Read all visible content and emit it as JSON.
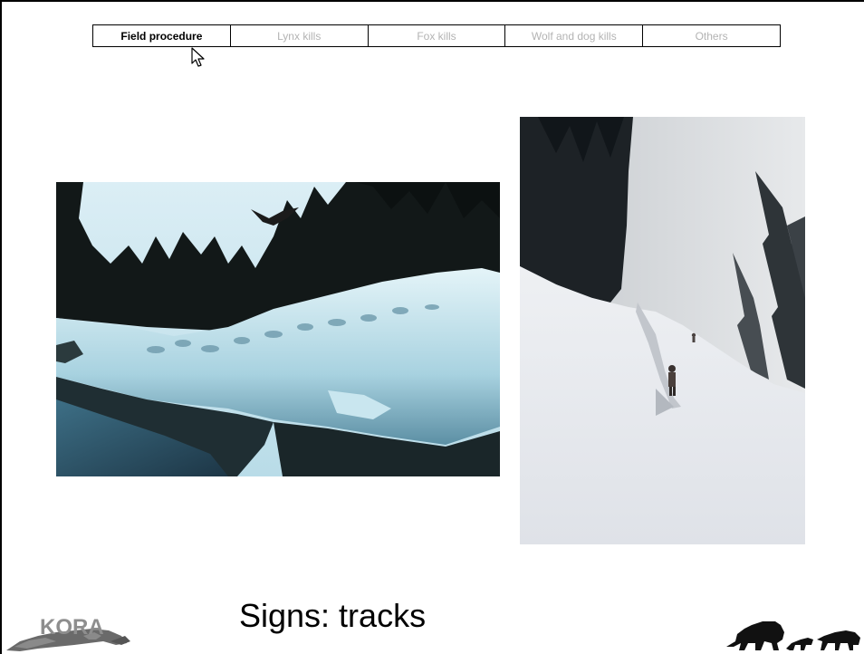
{
  "nav": {
    "tabs": [
      {
        "label": "Field procedure",
        "active": true
      },
      {
        "label": "Lynx kills",
        "active": false
      },
      {
        "label": "Fox kills",
        "active": false
      },
      {
        "label": "Wolf and dog kills",
        "active": false
      },
      {
        "label": "Others",
        "active": false
      }
    ]
  },
  "slide": {
    "title": "Signs: tracks"
  },
  "logos": {
    "left_text": "KORA"
  },
  "colors": {
    "active_tab": "#000000",
    "inactive_tab": "#b3b3b3",
    "snow": "#d9eef4",
    "forest": "#1a1f1f"
  },
  "icons": [
    "arrow-cursor-icon",
    "kora-logo",
    "animal-silhouettes-logo"
  ]
}
